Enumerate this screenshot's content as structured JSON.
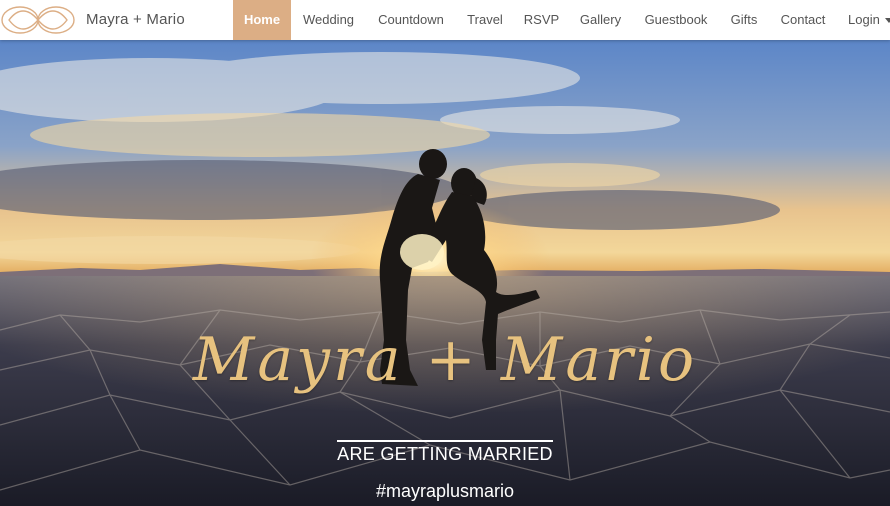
{
  "brand": {
    "name": "Mayra + Mario"
  },
  "nav": {
    "items": [
      {
        "label": "Home",
        "active": true
      },
      {
        "label": "Wedding"
      },
      {
        "label": "Countdown"
      },
      {
        "label": "Travel"
      },
      {
        "label": "RSVP"
      },
      {
        "label": "Gallery"
      },
      {
        "label": "Guestbook"
      },
      {
        "label": "Gifts"
      },
      {
        "label": "Contact"
      },
      {
        "label": "Login"
      }
    ]
  },
  "hero": {
    "names": "Mayra + Mario",
    "tagline": "ARE GETTING MARRIED",
    "hashtag": "#mayraplusmario"
  },
  "colors": {
    "accent": "#dcae85",
    "script_gold": "#e7c27f",
    "nav_text": "#555555"
  },
  "icons": {
    "logo": "infinity-rings-icon",
    "login_caret": "caret-down-icon"
  }
}
